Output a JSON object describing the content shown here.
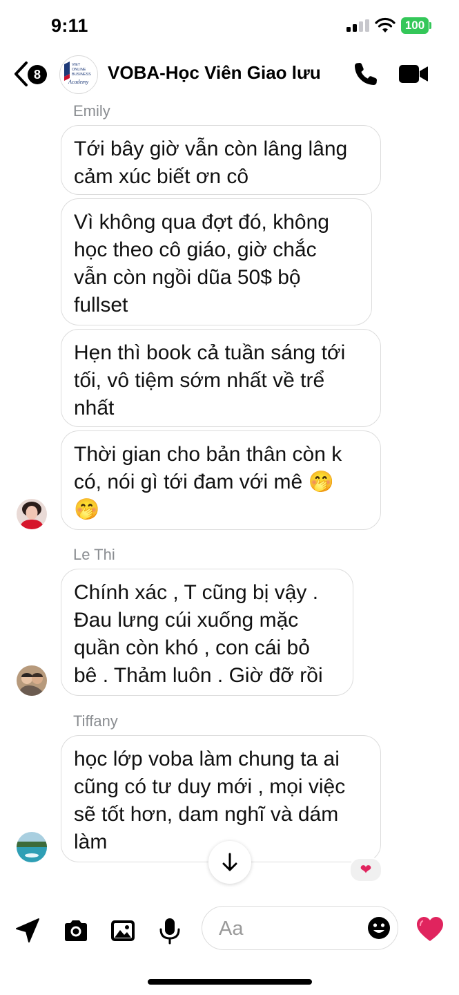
{
  "status_bar": {
    "time": "9:11",
    "battery": "100"
  },
  "header": {
    "back_badge": "8",
    "title": "VOBA-Học Viên Giao lưu",
    "avatar_text": [
      "VIET",
      "ONLINE",
      "BUSINESS",
      "Academy"
    ]
  },
  "messages": [
    {
      "sender": "Emily",
      "bubbles": [
        "Tới bây giờ vẫn còn lâng lâng\ncảm xúc biết ơn cô",
        "Vì không qua đợt đó, không\nhọc theo cô giáo, giờ chắc\nvẫn còn ngồi dũa 50$ bộ\nfullset",
        "Hẹn thì book cả tuần sáng tới\ntối, vô tiệm sớm nhất về trể\nnhất",
        "Thời gian cho bản thân còn k\ncó, nói gì tới đam với mê 🤭\n🤭"
      ]
    },
    {
      "sender": "Le Thi",
      "bubbles": [
        "Chính xác , T cũng bị vậy .\nĐau lưng cúi xuống mặc\nquần còn khó , con cái bỏ\nbê . Thảm luôn . Giờ đỡ rồi"
      ]
    },
    {
      "sender": "Tiffany",
      "bubbles": [
        "học lớp voba làm chung ta ai\ncũng có tư duy mới , mọi việc\nsẽ tốt hơn, dam nghĩ và dám\nlàm"
      ],
      "reaction": "❤"
    }
  ],
  "composer": {
    "placeholder": "Aa"
  },
  "colors": {
    "accent_red": "#e0245e",
    "battery_green": "#34c759",
    "bubble_border": "#dcdcdc",
    "sender_gray": "#8a8d91"
  }
}
